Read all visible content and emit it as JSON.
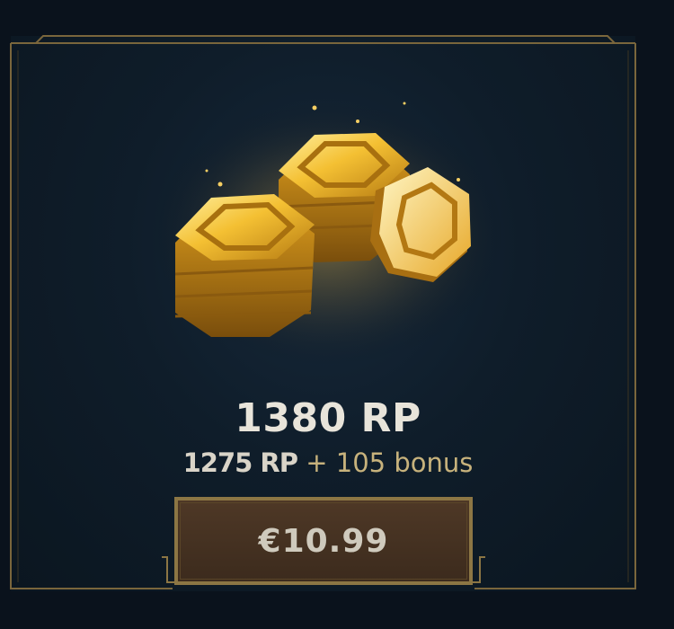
{
  "offer": {
    "icon": "rp-coin-stack-icon",
    "total": "1380 RP",
    "base": "1275 RP",
    "plus": "+",
    "bonus": "105 bonus",
    "price": "€10.99"
  },
  "colors": {
    "background": "#0a121c",
    "frame_gold": "#8c7644",
    "bonus_text": "#c7b27c",
    "button_fill": "#3c2b1d",
    "title_text": "#e8e4da"
  }
}
